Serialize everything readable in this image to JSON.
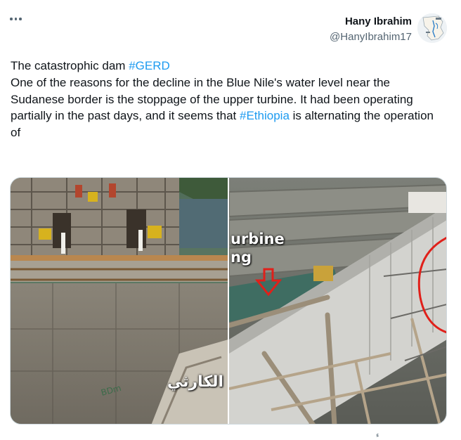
{
  "header": {
    "more_icon": "ellipsis-icon",
    "author_name": "Hany Ibrahim",
    "author_handle": "@HanyIbrahim17",
    "avatar_icon": "map-avatar"
  },
  "tweet": {
    "line1_text": "The catastrophic dam ",
    "hashtag_gerd": "#GERD",
    "body_part1": "One of the reasons for the decline in the Blue Nile's water level near the Sudanese border is the stoppage of the upper turbine. It had been operating partially in the past days, and it seems that ",
    "hashtag_ethiopia": "#Ethiopia",
    "body_part2": " is alternating the operation of",
    "link_color": "#1d9bf0"
  },
  "media": {
    "left_overlay_text": "الكارثي",
    "right_overlay_line1": "urbine",
    "right_overlay_line2": "ng",
    "annotation_color": "#e0201a"
  },
  "footer": {
    "glyph": "ء"
  }
}
